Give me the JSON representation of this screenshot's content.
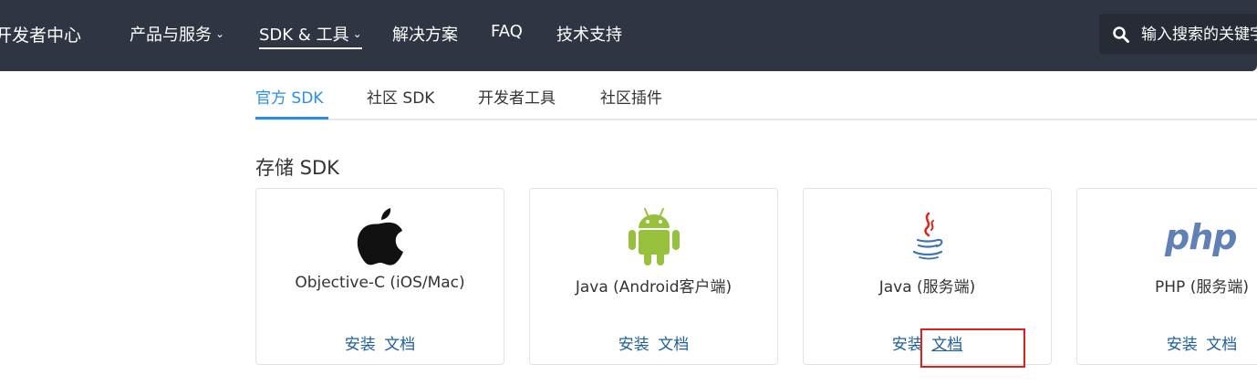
{
  "header": {
    "brand": "开发者中心",
    "nav": [
      {
        "label": "产品与服务",
        "has_dropdown": true,
        "active": false
      },
      {
        "label": "SDK & 工具",
        "has_dropdown": true,
        "active": true
      },
      {
        "label": "解决方案",
        "has_dropdown": false,
        "active": false
      },
      {
        "label": "FAQ",
        "has_dropdown": false,
        "active": false
      },
      {
        "label": "技术支持",
        "has_dropdown": false,
        "active": false
      }
    ],
    "search": {
      "placeholder": "输入搜索的关键字",
      "icon": "search-icon"
    }
  },
  "tabs": [
    {
      "label": "官方 SDK",
      "active": true
    },
    {
      "label": "社区 SDK",
      "active": false
    },
    {
      "label": "开发者工具",
      "active": false
    },
    {
      "label": "社区插件",
      "active": false
    }
  ],
  "section": {
    "title": "存储 SDK"
  },
  "cards": [
    {
      "name": "Objective-C (iOS/Mac)",
      "icon": "apple-logo-icon",
      "install": "安装",
      "docs": "文档"
    },
    {
      "name": "Java (Android客户端)",
      "icon": "android-logo-icon",
      "install": "安装",
      "docs": "文档"
    },
    {
      "name": "Java (服务端)",
      "icon": "java-logo-icon",
      "install": "安装",
      "docs": "文档"
    },
    {
      "name": "PHP (服务端)",
      "icon": "php-logo-icon",
      "install": "安装",
      "docs": "文档"
    }
  ],
  "colors": {
    "header_bg": "#2f3542",
    "accent": "#2b8ee6",
    "link": "#1f5f9e",
    "highlight": "#e01e1e"
  }
}
